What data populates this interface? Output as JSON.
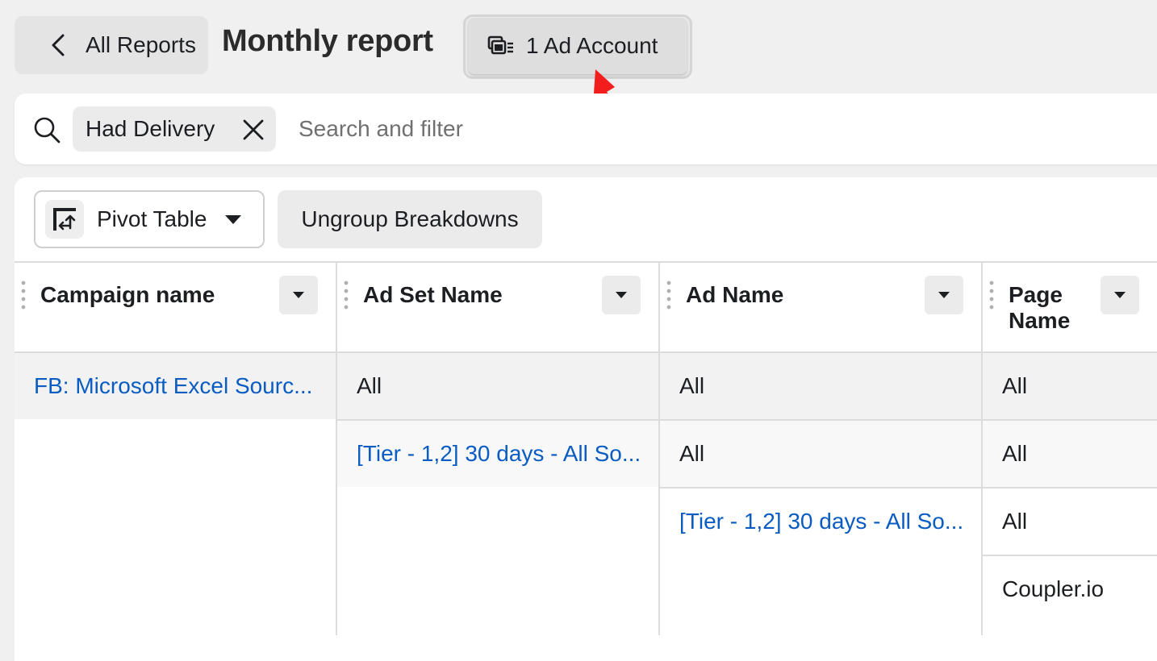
{
  "header": {
    "back_label": "All Reports",
    "title": "Monthly report",
    "account_label": "1 Ad Account"
  },
  "search": {
    "filter_chip": "Had Delivery",
    "placeholder": "Search and filter"
  },
  "toolbar": {
    "view_label": "Pivot Table",
    "ungroup_label": "Ungroup Breakdowns"
  },
  "table": {
    "columns": [
      {
        "label": "Campaign name"
      },
      {
        "label": "Ad Set Name"
      },
      {
        "label": "Ad Name"
      },
      {
        "label": "Page Name"
      }
    ],
    "rows": [
      {
        "campaign": "FB: Microsoft Excel Sourc...",
        "ad_set": "All",
        "ad_name": "All",
        "page": "All"
      },
      {
        "ad_set": "[Tier - 1,2] 30 days - All So...",
        "ad_name": "All",
        "page": "All"
      },
      {
        "ad_name": "[Tier - 1,2] 30 days - All So...",
        "page": "All"
      },
      {
        "page": "Coupler.io"
      }
    ]
  },
  "colors": {
    "link": "#0a5cc2",
    "annotation_arrow": "#f21d1d"
  },
  "icons": [
    "chevron-left-icon",
    "ad-accounts-icon",
    "search-icon",
    "close-icon",
    "pivot-table-icon",
    "caret-down-icon",
    "drag-handle-icon",
    "annotation-arrow"
  ]
}
